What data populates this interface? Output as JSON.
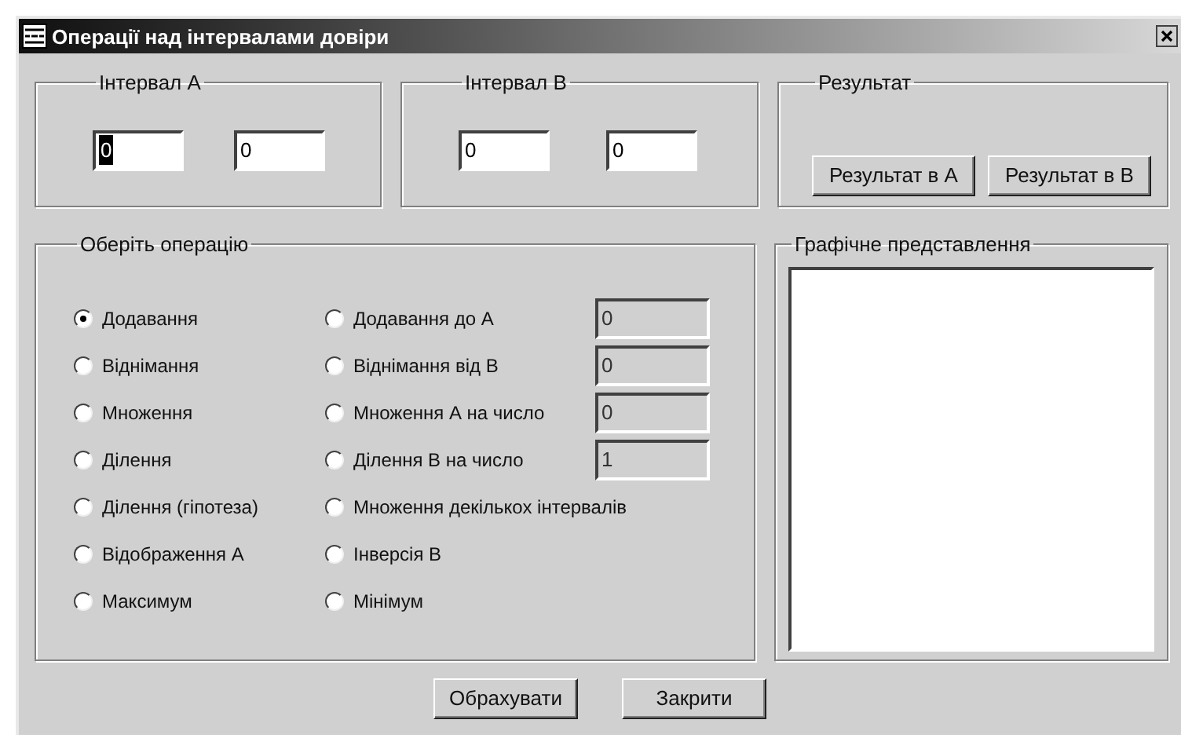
{
  "window": {
    "title": "Операції над інтервалами довіри"
  },
  "interval_a": {
    "title": "Інтервал А",
    "fields": [
      {
        "value": "0",
        "focused": true
      },
      {
        "value": "0",
        "focused": false
      }
    ]
  },
  "interval_b": {
    "title": "Інтервал В",
    "fields": [
      {
        "value": "0",
        "focused": false
      },
      {
        "value": "0",
        "focused": false
      }
    ]
  },
  "result": {
    "title": "Результат",
    "buttons": [
      "Результат в А",
      "Результат в В"
    ]
  },
  "operation": {
    "title": "Оберіть операцію",
    "columns": [
      {
        "options": [
          {
            "label": "Додавання",
            "selected": true
          },
          {
            "label": "Віднімання",
            "selected": false
          },
          {
            "label": "Множення",
            "selected": false
          },
          {
            "label": "Ділення",
            "selected": false
          },
          {
            "label": "Ділення (гіпотеза)",
            "selected": false
          },
          {
            "label": "Відображення А",
            "selected": false
          },
          {
            "label": "Максимум",
            "selected": false
          }
        ]
      },
      {
        "options": [
          {
            "label": "Додавання до А",
            "selected": false,
            "input": {
              "value": "0",
              "disabled": true
            }
          },
          {
            "label": "Віднімання від В",
            "selected": false,
            "input": {
              "value": "0",
              "disabled": true
            }
          },
          {
            "label": "Множення А на число",
            "selected": false,
            "input": {
              "value": "0",
              "disabled": true
            }
          },
          {
            "label": "Ділення В на число",
            "selected": false,
            "input": {
              "value": "1",
              "disabled": true
            }
          },
          {
            "label": "Множення декількох інтервалів",
            "selected": false
          },
          {
            "label": "Інверсія В",
            "selected": false
          },
          {
            "label": "Мінімум",
            "selected": false
          }
        ]
      }
    ]
  },
  "graphic": {
    "title": "Графічне представлення"
  },
  "buttons": [
    "Обрахувати",
    "Закрити"
  ]
}
